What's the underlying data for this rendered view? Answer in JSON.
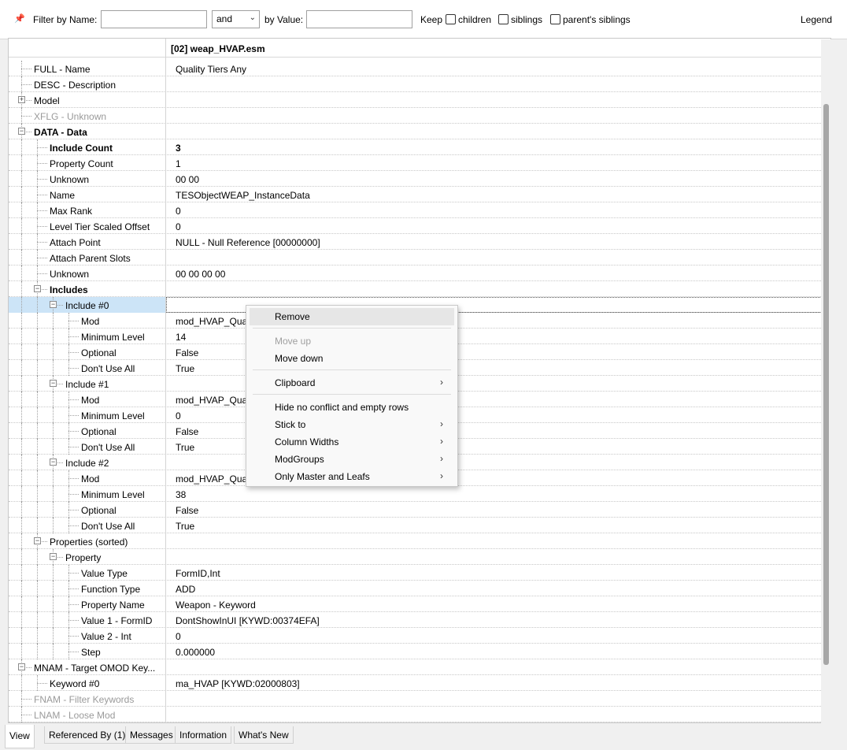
{
  "filter": {
    "filter_by_name_label": "Filter by Name:",
    "name_value": "",
    "operator": "and",
    "by_value_label": "by Value:",
    "value_value": "",
    "keep_label": "Keep",
    "children_label": "children",
    "siblings_label": "siblings",
    "parents_siblings_label": "parent's siblings",
    "legend_label": "Legend"
  },
  "grid": {
    "header_title": "[02] weap_HVAP.esm",
    "rows": [
      {
        "name": "FULL - Name",
        "value": "Quality Tiers Any"
      },
      {
        "name": "DESC - Description",
        "value": ""
      },
      {
        "name": "Model",
        "value": ""
      },
      {
        "name": "XFLG - Unknown",
        "value": ""
      },
      {
        "name": "DATA - Data",
        "value": ""
      },
      {
        "name": "Include Count",
        "value": "3"
      },
      {
        "name": "Property Count",
        "value": "1"
      },
      {
        "name": "Unknown",
        "value": "00 00"
      },
      {
        "name": "Name",
        "value": "TESObjectWEAP_InstanceData"
      },
      {
        "name": "Max Rank",
        "value": "0"
      },
      {
        "name": "Level Tier Scaled Offset",
        "value": "0"
      },
      {
        "name": "Attach Point",
        "value": "NULL - Null Reference [00000000]"
      },
      {
        "name": "Attach Parent Slots",
        "value": ""
      },
      {
        "name": "Unknown",
        "value": "00 00 00 00"
      },
      {
        "name": "Includes",
        "value": ""
      },
      {
        "name": "Include #0",
        "value": ""
      },
      {
        "name": "Mod",
        "value": "mod_HVAP_Qual"
      },
      {
        "name": "Minimum Level",
        "value": "14"
      },
      {
        "name": "Optional",
        "value": "False"
      },
      {
        "name": "Don't Use All",
        "value": "True"
      },
      {
        "name": "Include #1",
        "value": ""
      },
      {
        "name": "Mod",
        "value": "mod_HVAP_Qual"
      },
      {
        "name": "Minimum Level",
        "value": "0"
      },
      {
        "name": "Optional",
        "value": "False"
      },
      {
        "name": "Don't Use All",
        "value": "True"
      },
      {
        "name": "Include #2",
        "value": ""
      },
      {
        "name": "Mod",
        "value": "mod_HVAP_Qual"
      },
      {
        "name": "Minimum Level",
        "value": "38"
      },
      {
        "name": "Optional",
        "value": "False"
      },
      {
        "name": "Don't Use All",
        "value": "True"
      },
      {
        "name": "Properties (sorted)",
        "value": ""
      },
      {
        "name": "Property",
        "value": ""
      },
      {
        "name": "Value Type",
        "value": "FormID,Int"
      },
      {
        "name": "Function Type",
        "value": "ADD"
      },
      {
        "name": "Property Name",
        "value": "Weapon - Keyword"
      },
      {
        "name": "Value 1 - FormID",
        "value": "DontShowInUI [KYWD:00374EFA]"
      },
      {
        "name": "Value 2 - Int",
        "value": "0"
      },
      {
        "name": "Step",
        "value": "0.000000"
      },
      {
        "name": "MNAM - Target OMOD Key...",
        "value": ""
      },
      {
        "name": "Keyword #0",
        "value": "ma_HVAP [KYWD:02000803]"
      },
      {
        "name": "FNAM - Filter Keywords",
        "value": ""
      },
      {
        "name": "LNAM - Loose Mod",
        "value": ""
      }
    ]
  },
  "context_menu": {
    "items": [
      {
        "label": "Remove",
        "enabled": true,
        "submenu": false
      },
      {
        "label": "Move up",
        "enabled": false,
        "submenu": false
      },
      {
        "label": "Move down",
        "enabled": true,
        "submenu": false
      },
      {
        "label": "Clipboard",
        "enabled": true,
        "submenu": true
      },
      {
        "label": "Hide no conflict and empty rows",
        "enabled": true,
        "submenu": false
      },
      {
        "label": "Stick to",
        "enabled": true,
        "submenu": true
      },
      {
        "label": "Column Widths",
        "enabled": true,
        "submenu": true
      },
      {
        "label": "ModGroups",
        "enabled": true,
        "submenu": true
      },
      {
        "label": "Only Master and Leafs",
        "enabled": true,
        "submenu": true
      }
    ]
  },
  "tabs": [
    {
      "label": "View",
      "active": true
    },
    {
      "label": "Referenced By (1)",
      "active": false
    },
    {
      "label": "Messages",
      "active": false
    },
    {
      "label": "Information",
      "active": false
    },
    {
      "label": "What's New",
      "active": false
    }
  ],
  "colors": {
    "selection": "#cce4f7",
    "disabled_text": "#9a9a9a",
    "menu_hover": "#e6e6e6"
  }
}
